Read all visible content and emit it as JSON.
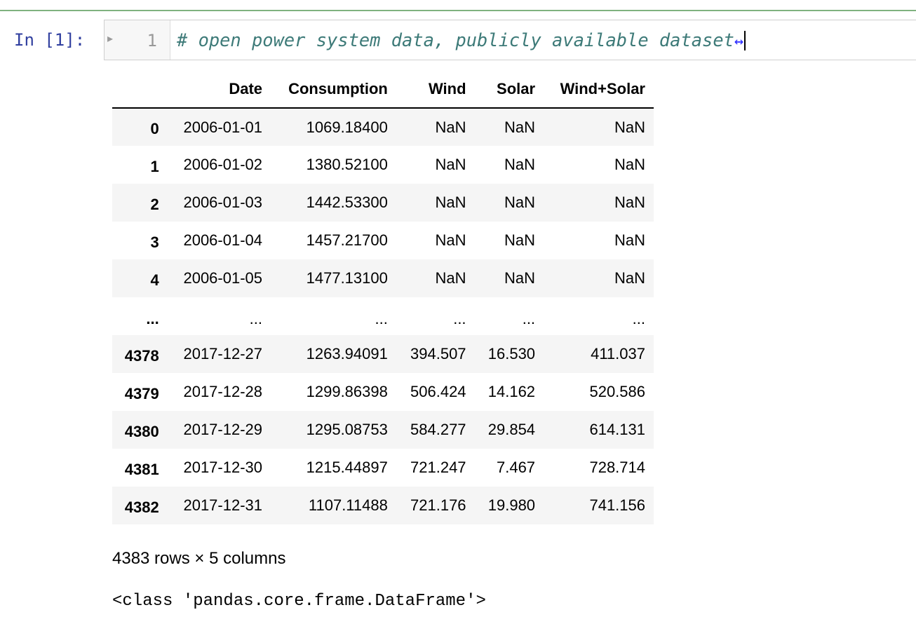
{
  "cell": {
    "prompt": "In [1]:",
    "line_number": "1",
    "code_comment": "# open power system data, publicly available dataset",
    "fold_marker": "↔"
  },
  "table": {
    "columns": [
      "",
      "Date",
      "Consumption",
      "Wind",
      "Solar",
      "Wind+Solar"
    ],
    "rows": [
      [
        "0",
        "2006-01-01",
        "1069.18400",
        "NaN",
        "NaN",
        "NaN"
      ],
      [
        "1",
        "2006-01-02",
        "1380.52100",
        "NaN",
        "NaN",
        "NaN"
      ],
      [
        "2",
        "2006-01-03",
        "1442.53300",
        "NaN",
        "NaN",
        "NaN"
      ],
      [
        "3",
        "2006-01-04",
        "1457.21700",
        "NaN",
        "NaN",
        "NaN"
      ],
      [
        "4",
        "2006-01-05",
        "1477.13100",
        "NaN",
        "NaN",
        "NaN"
      ],
      [
        "...",
        "...",
        "...",
        "...",
        "...",
        "..."
      ],
      [
        "4378",
        "2017-12-27",
        "1263.94091",
        "394.507",
        "16.530",
        "411.037"
      ],
      [
        "4379",
        "2017-12-28",
        "1299.86398",
        "506.424",
        "14.162",
        "520.586"
      ],
      [
        "4380",
        "2017-12-29",
        "1295.08753",
        "584.277",
        "29.854",
        "614.131"
      ],
      [
        "4381",
        "2017-12-30",
        "1215.44897",
        "721.247",
        "7.467",
        "728.714"
      ],
      [
        "4382",
        "2017-12-31",
        "1107.11488",
        "721.176",
        "19.980",
        "741.156"
      ]
    ],
    "shape_text": "4383 rows × 5 columns"
  },
  "output": {
    "class_text": "<class 'pandas.core.frame.DataFrame'>"
  }
}
